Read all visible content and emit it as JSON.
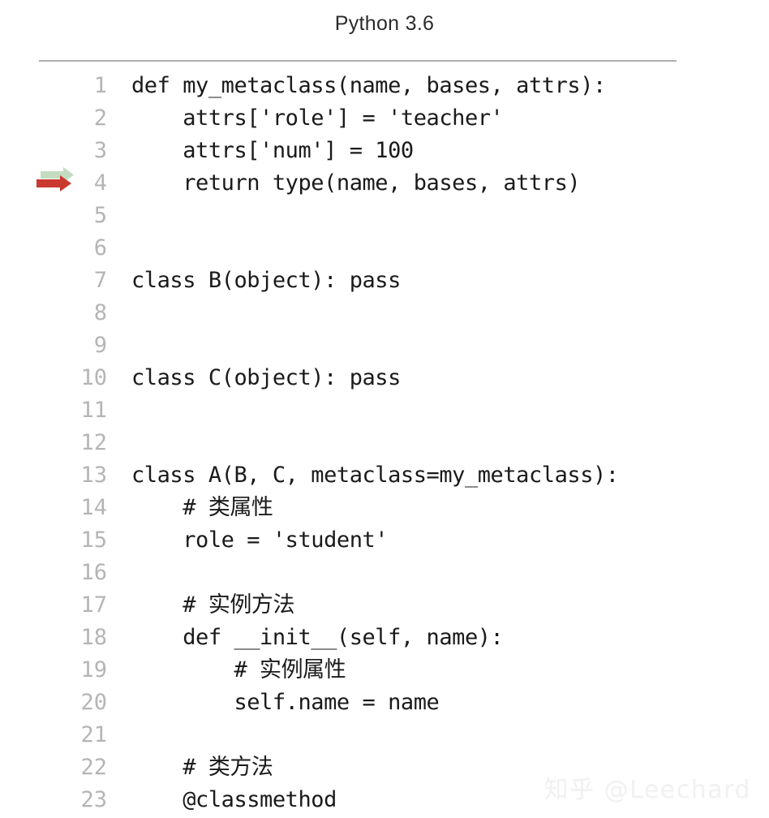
{
  "header": {
    "title": "Python 3.6"
  },
  "colors": {
    "background": "#ffffff",
    "code_text": "#1a1a1a",
    "line_number": "#b5b5b5",
    "divider": "#b0b0b0",
    "arrow_green": "#c3dcc0",
    "arrow_red": "#c9392f",
    "watermark": "#f1f1f1",
    "title_text": "#2b2b2b"
  },
  "marker": {
    "line": 4,
    "green_icon": "arrow-right-icon",
    "red_icon": "arrow-right-icon"
  },
  "editor": {
    "lines": [
      {
        "n": "1",
        "code": "def my_metaclass(name, bases, attrs):"
      },
      {
        "n": "2",
        "code": "    attrs['role'] = 'teacher'"
      },
      {
        "n": "3",
        "code": "    attrs['num'] = 100"
      },
      {
        "n": "4",
        "code": "    return type(name, bases, attrs)"
      },
      {
        "n": "5",
        "code": ""
      },
      {
        "n": "6",
        "code": ""
      },
      {
        "n": "7",
        "code": "class B(object): pass"
      },
      {
        "n": "8",
        "code": ""
      },
      {
        "n": "9",
        "code": ""
      },
      {
        "n": "10",
        "code": "class C(object): pass"
      },
      {
        "n": "11",
        "code": ""
      },
      {
        "n": "12",
        "code": ""
      },
      {
        "n": "13",
        "code": "class A(B, C, metaclass=my_metaclass):"
      },
      {
        "n": "14",
        "code": "    # 类属性"
      },
      {
        "n": "15",
        "code": "    role = 'student'"
      },
      {
        "n": "16",
        "code": ""
      },
      {
        "n": "17",
        "code": "    # 实例方法"
      },
      {
        "n": "18",
        "code": "    def __init__(self, name):"
      },
      {
        "n": "19",
        "code": "        # 实例属性"
      },
      {
        "n": "20",
        "code": "        self.name = name"
      },
      {
        "n": "21",
        "code": ""
      },
      {
        "n": "22",
        "code": "    # 类方法"
      },
      {
        "n": "23",
        "code": "    @classmethod"
      }
    ]
  },
  "watermark": {
    "text": "知乎 @Leechard"
  }
}
